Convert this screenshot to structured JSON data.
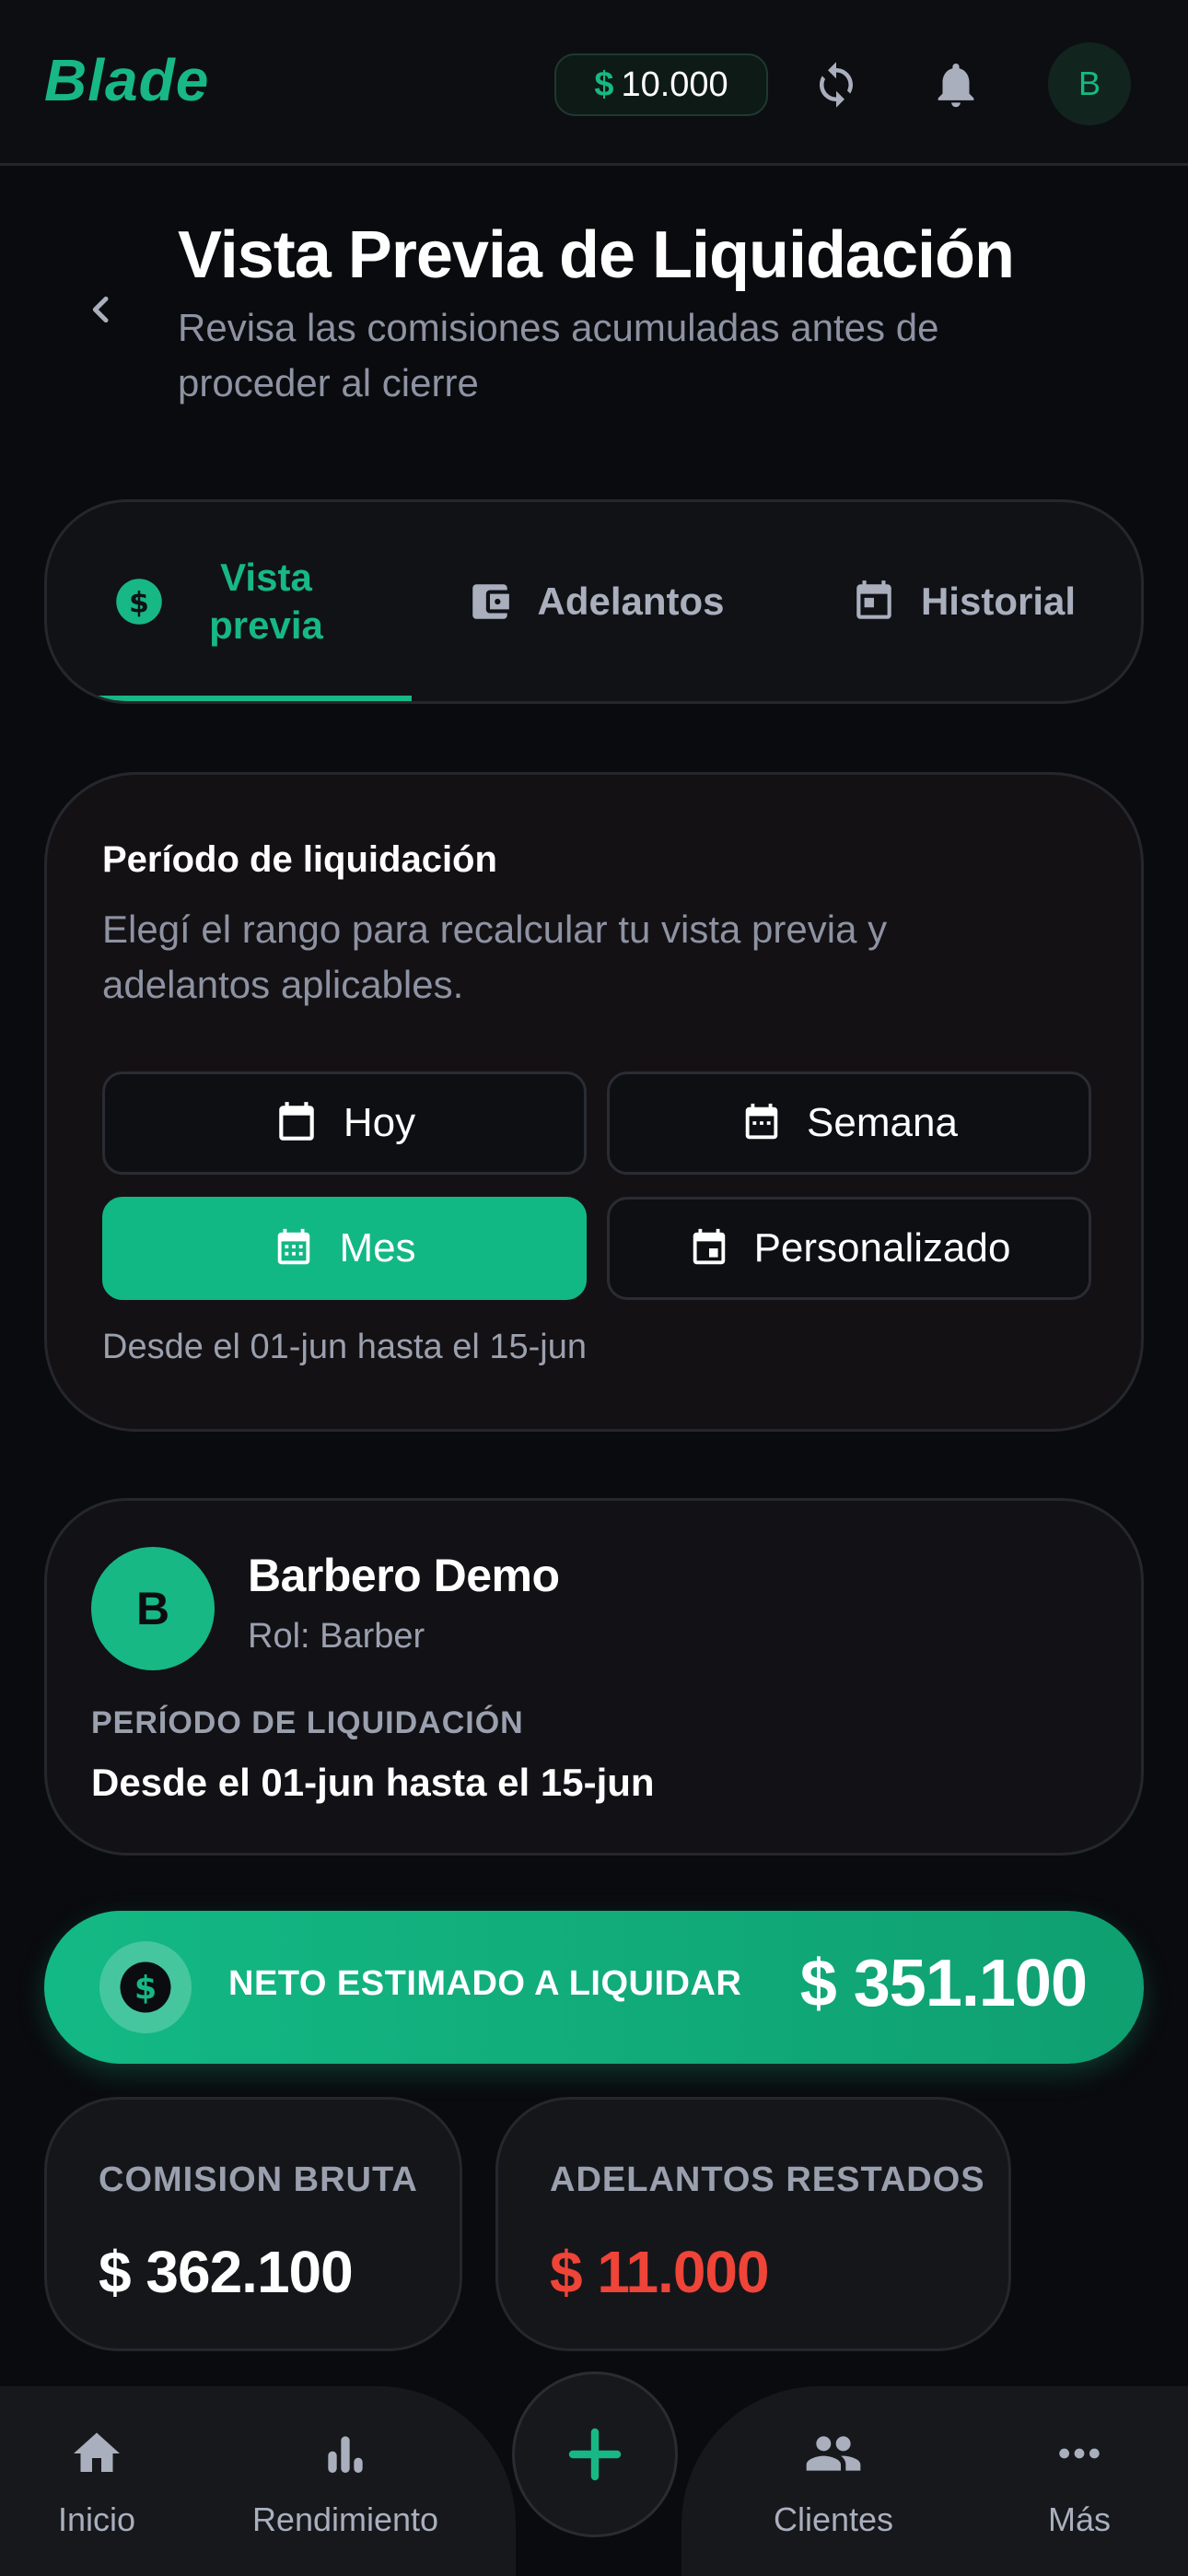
{
  "topbar": {
    "brand": "Blade",
    "balance_currency": "$",
    "balance_amount": "10.000",
    "avatar_initial": "B"
  },
  "header": {
    "title": "Vista Previa de Liquidación",
    "subtitle": "Revisa las comisiones acumuladas antes de proceder al cierre"
  },
  "tabs": [
    {
      "label": "Vista previa",
      "icon": "dollar-circle-icon",
      "active": true
    },
    {
      "label": "Adelantos",
      "icon": "wallet-icon",
      "active": false
    },
    {
      "label": "Historial",
      "icon": "calendar-icon",
      "active": false
    }
  ],
  "period": {
    "title": "Período de liquidación",
    "description": "Elegí el rango para recalcular tu vista previa y adelantos aplicables.",
    "options": [
      {
        "label": "Hoy",
        "icon": "calendar-blank-icon",
        "active": false
      },
      {
        "label": "Semana",
        "icon": "calendar-week-icon",
        "active": false
      },
      {
        "label": "Mes",
        "icon": "calendar-month-icon",
        "active": true
      },
      {
        "label": "Personalizado",
        "icon": "calendar-custom-icon",
        "active": false
      }
    ],
    "range_text": "Desde el 01-jun hasta el 15-jun"
  },
  "barber": {
    "initial": "B",
    "name": "Barbero Demo",
    "role": "Rol: Barber",
    "period_label": "PERÍODO DE LIQUIDACIÓN",
    "period_range": "Desde el 01-jun hasta el 15-jun"
  },
  "net": {
    "label": "NETO ESTIMADO A LIQUIDAR",
    "value": "$ 351.100"
  },
  "stats": {
    "gross_label": "COMISION BRUTA",
    "gross_value": "$ 362.100",
    "advances_label": "ADELANTOS RESTADOS",
    "advances_value": "$ 11.000"
  },
  "nav": {
    "items": [
      {
        "label": "Inicio",
        "icon": "home-icon"
      },
      {
        "label": "Rendimiento",
        "icon": "bar-chart-icon"
      },
      {
        "label": "Clientes",
        "icon": "people-icon"
      },
      {
        "label": "Más",
        "icon": "more-icon"
      }
    ],
    "fab_icon": "plus-icon"
  },
  "colors": {
    "accent": "#17b883",
    "background": "#0a0b0e",
    "danger": "#ef4438",
    "muted": "#9aa0ae"
  }
}
